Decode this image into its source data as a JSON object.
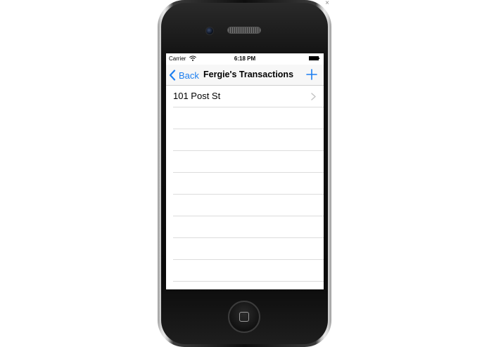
{
  "status_bar": {
    "carrier": "Carrier",
    "time": "6:18 PM"
  },
  "nav_bar": {
    "back_label": "Back",
    "title": "Fergie's Transactions",
    "add_icon": "plus-icon",
    "back_icon": "chevron-left-icon"
  },
  "list": {
    "items": [
      {
        "label": "101 Post St"
      },
      {
        "label": ""
      },
      {
        "label": ""
      },
      {
        "label": ""
      },
      {
        "label": ""
      },
      {
        "label": ""
      },
      {
        "label": ""
      },
      {
        "label": ""
      },
      {
        "label": ""
      },
      {
        "label": ""
      },
      {
        "label": ""
      }
    ]
  },
  "colors": {
    "accent": "#1d7ff0",
    "nav_background": "#f7f7f7",
    "separator": "#dcdcdc"
  }
}
